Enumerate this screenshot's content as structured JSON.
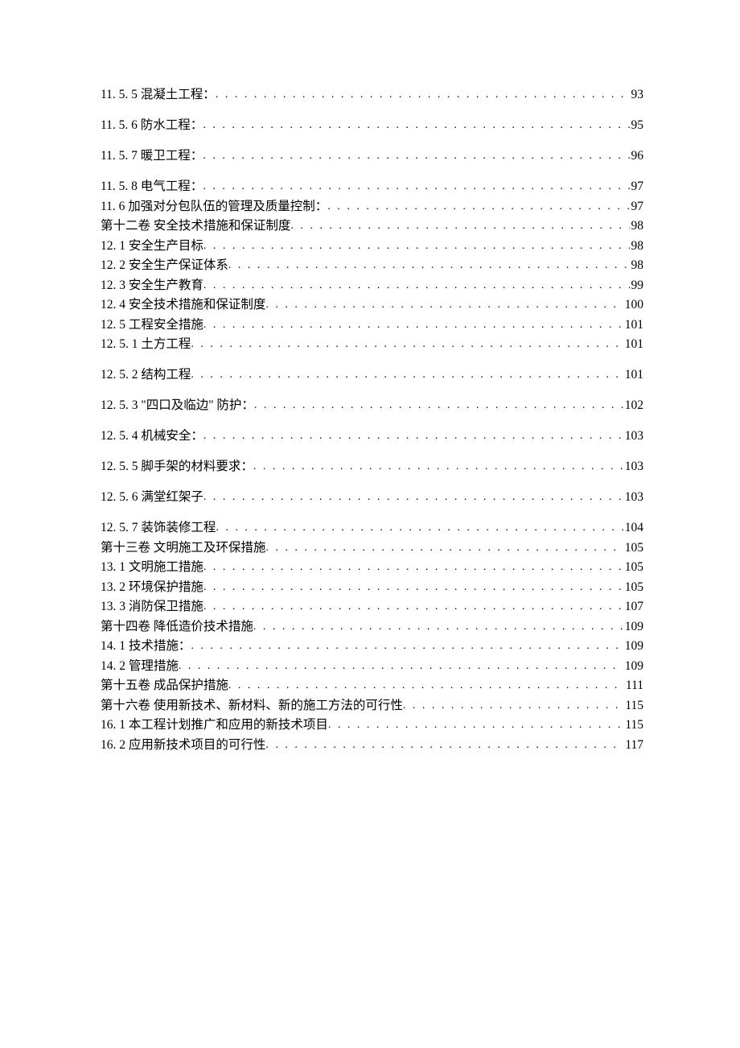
{
  "toc": [
    {
      "title": "11. 5. 5 混凝土工程：",
      "page": "93",
      "spaced": true
    },
    {
      "title": "11. 5. 6 防水工程：",
      "page": "95",
      "spaced": true
    },
    {
      "title": "11. 5. 7 暖卫工程：",
      "page": "96",
      "spaced": true
    },
    {
      "title": "11. 5. 8 电气工程：",
      "page": "97",
      "spaced": false
    },
    {
      "title": "11. 6 加强对分包队伍的管理及质量控制：",
      "page": "97",
      "spaced": false
    },
    {
      "title": "第十二卷   安全技术措施和保证制度",
      "page": "98",
      "spaced": false
    },
    {
      "title": "12. 1 安全生产目标",
      "page": "98",
      "spaced": false
    },
    {
      "title": "12. 2 安全生产保证体系",
      "page": "98",
      "spaced": false
    },
    {
      "title": "12. 3 安全生产教育",
      "page": "99",
      "spaced": false
    },
    {
      "title": "12. 4 安全技术措施和保证制度",
      "page": "100",
      "spaced": false
    },
    {
      "title": "12. 5 工程安全措施",
      "page": "101",
      "spaced": false
    },
    {
      "title": "12. 5. 1 土方工程",
      "page": "101",
      "spaced": true
    },
    {
      "title": "12. 5. 2 结构工程",
      "page": "101",
      "spaced": true
    },
    {
      "title": "12. 5. 3 \"四口及临边\" 防护：",
      "page": "102",
      "spaced": true
    },
    {
      "title": "12. 5. 4 机械安全：",
      "page": "103",
      "spaced": true
    },
    {
      "title": "12. 5. 5 脚手架的材料要求：",
      "page": "103",
      "spaced": true
    },
    {
      "title": "12. 5. 6 满堂红架子",
      "page": "103",
      "spaced": true
    },
    {
      "title": "12. 5. 7 装饰装修工程",
      "page": "104",
      "spaced": false
    },
    {
      "title": "第十三卷 文明施工及环保措施",
      "page": "105",
      "spaced": false
    },
    {
      "title": "13. 1 文明施工措施",
      "page": "105",
      "spaced": false
    },
    {
      "title": "13. 2 环境保护措施",
      "page": "105",
      "spaced": false
    },
    {
      "title": "13. 3 消防保卫措施",
      "page": "107",
      "spaced": false
    },
    {
      "title": "第十四卷 降低造价技术措施",
      "page": "109",
      "spaced": false
    },
    {
      "title": "14. 1 技术措施：",
      "page": "109",
      "spaced": false
    },
    {
      "title": "14. 2 管理措施",
      "page": "109",
      "spaced": false
    },
    {
      "title": "第十五卷 成品保护措施",
      "page": "111",
      "spaced": false
    },
    {
      "title": "第十六卷   使用新技术、新材料、新的施工方法的可行性",
      "page": "115",
      "spaced": false
    },
    {
      "title": "16. 1 本工程计划推广和应用的新技术项目",
      "page": "115",
      "spaced": false
    },
    {
      "title": "16. 2 应用新技术项目的可行性",
      "page": "117",
      "spaced": false
    }
  ]
}
